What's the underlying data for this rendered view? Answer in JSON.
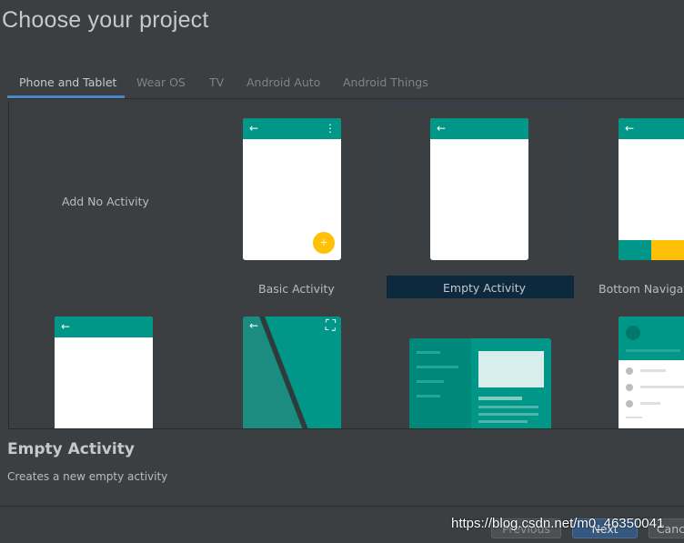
{
  "title": "Choose your project",
  "tabs": [
    "Phone and Tablet",
    "Wear OS",
    "TV",
    "Android Auto",
    "Android Things"
  ],
  "templates": {
    "add_no_activity": "Add No Activity",
    "basic_activity": "Basic Activity",
    "empty_activity": "Empty Activity",
    "bottom_navigation": "Bottom Navigati"
  },
  "details": {
    "name": "Empty Activity",
    "description": "Creates a new empty activity"
  },
  "buttons": {
    "previous": "Previous",
    "next": "Next",
    "cancel": "Cancel"
  },
  "watermark": "https://blog.csdn.net/m0_46350041",
  "icons": {
    "back": "←",
    "overflow": "⋮",
    "add": "+",
    "fullscreen": "⛶"
  },
  "colors": {
    "teal": "#009688",
    "accent": "#ffc107",
    "selection": "#0d293e",
    "tab_underline": "#4a88c7"
  }
}
